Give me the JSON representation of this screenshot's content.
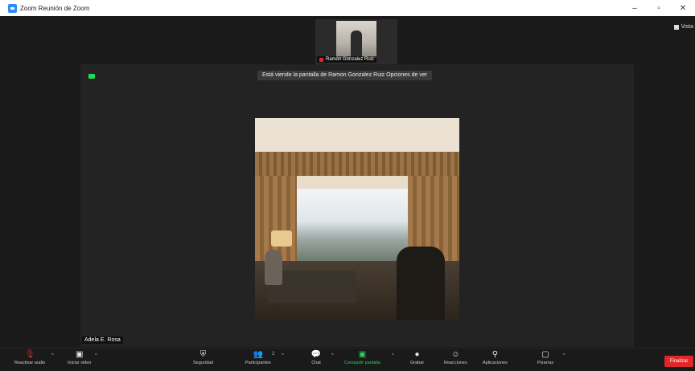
{
  "window": {
    "title": "Zoom Reunión de Zoom",
    "controls": {
      "minimize": "–",
      "maximize": "▫",
      "close": "✕"
    }
  },
  "gallery": {
    "thumbnail_name": "Ramón Gonzalez Ruiz",
    "view_label": "Vista"
  },
  "share": {
    "banner": "Está viendo la pantalla de Ramon Gonzalez Ruiz   Opciones de ver",
    "presenter_name": "Adela E. Rosa"
  },
  "toolbar": {
    "items": [
      {
        "label": "Reactivar audio",
        "icon": "mic-off-icon"
      },
      {
        "label": "Iniciar video",
        "icon": "video-off-icon"
      },
      {
        "label": "Seguridad",
        "icon": "shield-icon"
      },
      {
        "label": "Participantes",
        "icon": "participants-icon",
        "count": "2"
      },
      {
        "label": "Chat",
        "icon": "chat-icon"
      },
      {
        "label": "Compartir pantalla",
        "icon": "share-screen-icon"
      },
      {
        "label": "Grabar",
        "icon": "record-icon"
      },
      {
        "label": "Reacciones",
        "icon": "reactions-icon"
      },
      {
        "label": "Aplicaciones",
        "icon": "apps-icon"
      },
      {
        "label": "Pizarras",
        "icon": "whiteboard-icon"
      }
    ],
    "end_label": "Finalizar"
  },
  "colors": {
    "accent_green": "#23d959",
    "end_red": "#e02828",
    "zoom_blue": "#2d8cff"
  }
}
